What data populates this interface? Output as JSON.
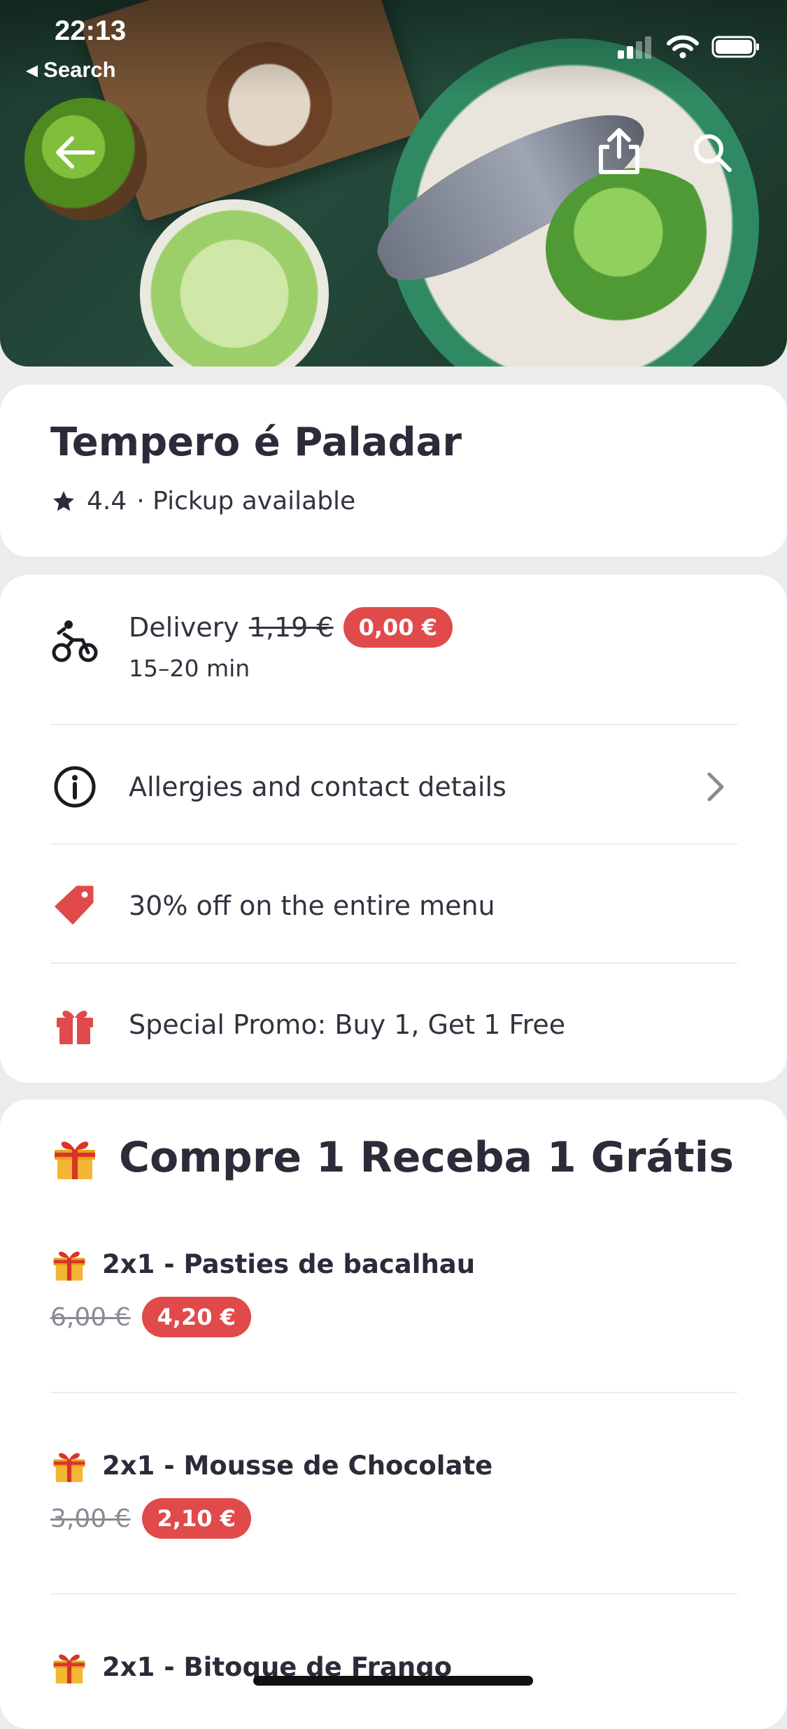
{
  "status_bar": {
    "time": "22:13",
    "back_label": "◂ Search"
  },
  "restaurant": {
    "name": "Tempero é Paladar",
    "rating": "4.4",
    "meta_suffix": "· Pickup available"
  },
  "info": {
    "delivery_label": "Delivery",
    "delivery_old_price": "1,19 €",
    "delivery_new_price": "0,00 €",
    "delivery_time": "15–20 min",
    "allergies_label": "Allergies and contact details",
    "discount_label": "30% off on the entire menu",
    "promo_label": "Special Promo: Buy 1, Get 1 Free"
  },
  "section": {
    "title": "Compre 1 Receba 1 Grátis",
    "items": [
      {
        "name": "2x1 - Pasties de bacalhau",
        "old_price": "6,00 €",
        "new_price": "4,20 €"
      },
      {
        "name": "2x1 - Mousse de Chocolate",
        "old_price": "3,00 €",
        "new_price": "2,10 €"
      },
      {
        "name": "2x1 - Bitoque de Frango"
      }
    ]
  },
  "colors": {
    "accent_red": "#e04a4a",
    "text_dark": "#2b2b3a",
    "background": "#ececee"
  }
}
